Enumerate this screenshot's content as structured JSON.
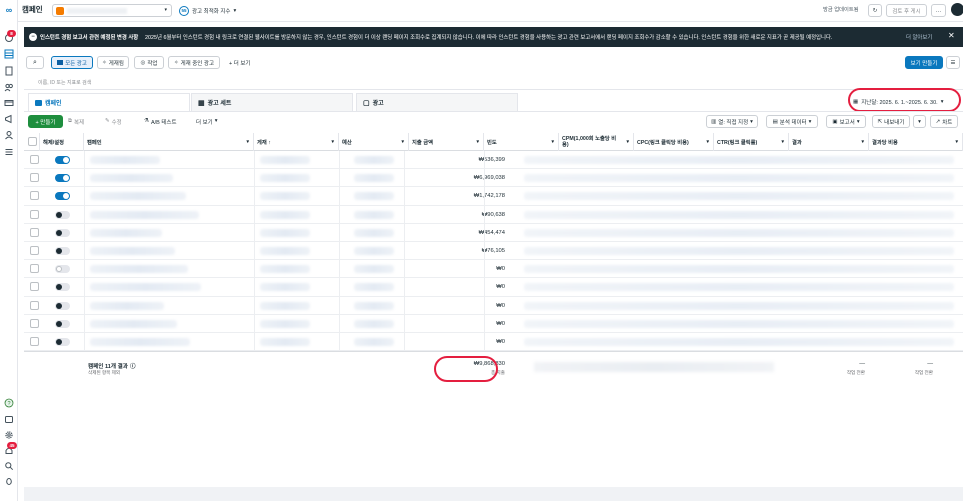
{
  "app": {
    "title": "캠페인",
    "opportunity_score": "광고 최적화 지수",
    "opportunity_badge": "55",
    "request_update": "방금 업데이트됨",
    "review_publish": "검토 후 게시",
    "more": "…"
  },
  "banner": {
    "title": "인스턴트 경험 보고서 관련 예정된 변경 사항",
    "text": "2025년 6월부터 인스턴트 경험 내 링크로 연결된 웹사이트를 방문하지 않는 경우, 인스턴트 경험이 더 이상 랜딩 페이지 조회수로 집계되지 않습니다. 이에 따라 인스턴트 경험을 사용하는 광고 관련 보고서에서 랜딩 페이지 조회수가 감소할 수 있습니다. 인스턴트 경험을 위한 새로운 지표가 곧 제공될 예정입니다.",
    "learn_more": "더 알아보기"
  },
  "filters": {
    "all_ads": "모든 광고",
    "published": "게재됨",
    "active": "작업",
    "active_ads": "게재 중인 광고",
    "more": "+ 더 보기",
    "view_settings": "보기 만들기",
    "search_placeholder": "이름, ID 또는 지표로 검색"
  },
  "tabs": [
    {
      "label": "캠페인"
    },
    {
      "label": "광고 세트"
    },
    {
      "label": "광고"
    }
  ],
  "date_range": "지난달: 2025. 6. 1.~2025. 6. 30.",
  "toolbar": {
    "create": "+ 만들기",
    "duplicate": "복제",
    "edit": "수정",
    "ab_test": "A/B 테스트",
    "more": "더 보기",
    "columns": "열: 직접 지정",
    "breakdown": "분석 데이터",
    "reports": "보고서",
    "export": "내보내기",
    "chart": "차트"
  },
  "columns": {
    "onoff": "해제/설정",
    "campaign": "캠페인",
    "delivery": "게재 ↑",
    "budget": "예산",
    "amount_spent": "지출 금액",
    "frequency": "빈도",
    "cpm": "CPM(1,000회 노출당 비용)",
    "cpc": "CPC(링크 클릭당 비용)",
    "ctr": "CTR(링크 클릭률)",
    "results": "결과",
    "cost_per_result": "결과당 비용"
  },
  "rows": [
    {
      "toggle": "on",
      "spent": "₩536,399"
    },
    {
      "toggle": "on",
      "spent": "₩6,969,038"
    },
    {
      "toggle": "on",
      "spent": "₩1,742,178"
    },
    {
      "toggle": "off",
      "spent": "₩90,638"
    },
    {
      "toggle": "off",
      "spent": "₩454,474"
    },
    {
      "toggle": "off",
      "spent": "₩76,105"
    },
    {
      "toggle": "offdim",
      "spent": "₩0"
    },
    {
      "toggle": "off",
      "spent": "₩0"
    },
    {
      "toggle": "off",
      "spent": "₩0"
    },
    {
      "toggle": "off",
      "spent": "₩0"
    },
    {
      "toggle": "off",
      "spent": "₩0"
    }
  ],
  "summary": {
    "label": "캠페인 11개 결과",
    "sublabel": "삭제된 항목 제외",
    "total_spent": "₩9,868,830",
    "total_spent_sub": "총 지출",
    "results_dash": "—",
    "results_sub": "작업 전환",
    "cost_dash": "—",
    "cost_sub": "작업 전환"
  },
  "colors": {
    "accent": "#0a78be",
    "banner_bg": "#1c2b33",
    "highlight": "#e41e3f"
  },
  "rail_badges": {
    "top": "8",
    "bottom": "45"
  }
}
